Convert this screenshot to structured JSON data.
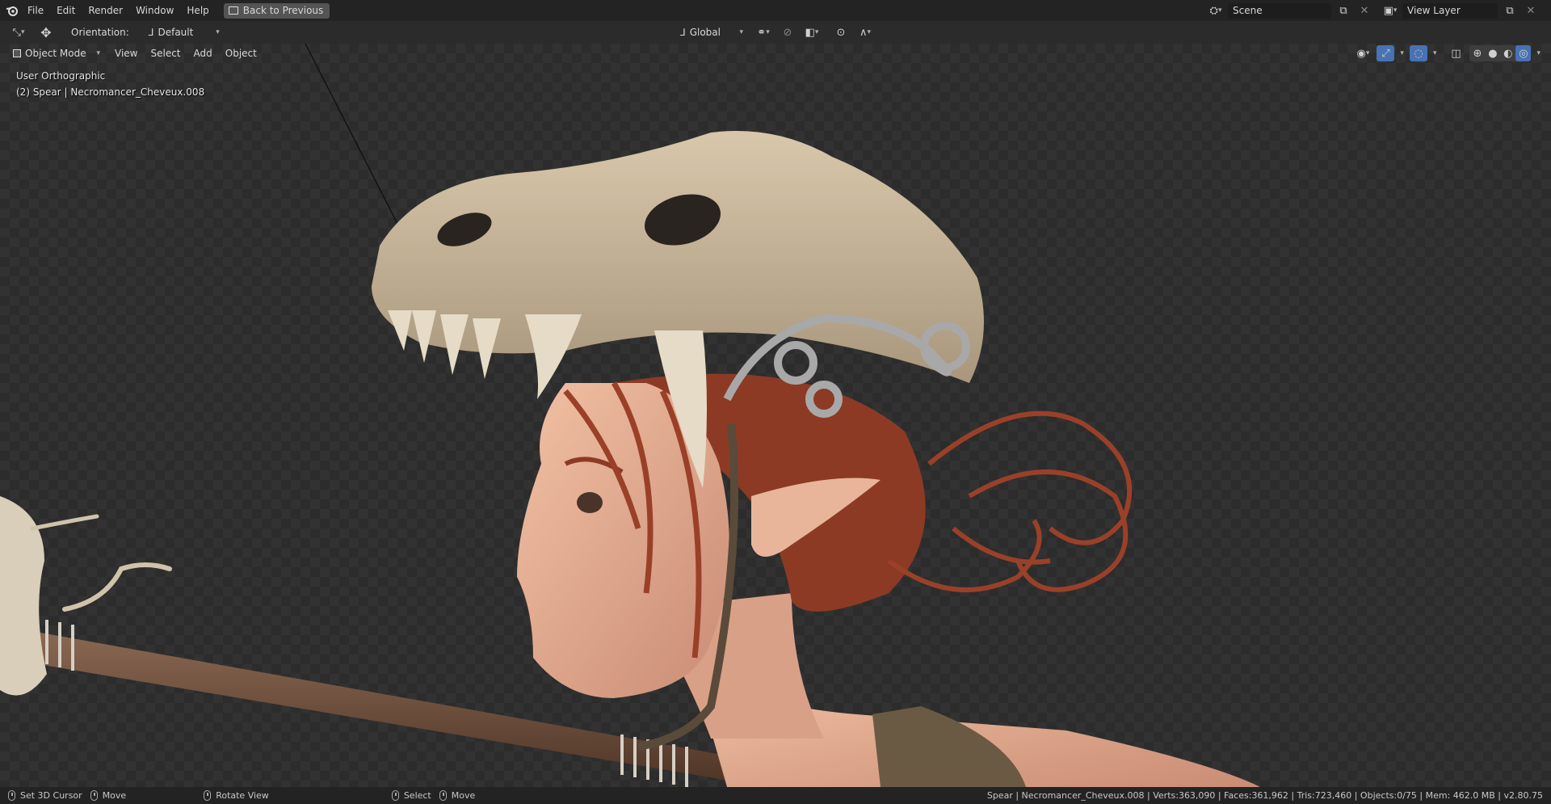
{
  "topbar": {
    "menu": [
      "File",
      "Edit",
      "Render",
      "Window",
      "Help"
    ],
    "back_label": "Back to Previous",
    "scene_value": "Scene",
    "view_layer_value": "View Layer"
  },
  "toolbar": {
    "orientation_label": "Orientation:",
    "orientation_value": "Default",
    "transform_orientation": "Global"
  },
  "viewport": {
    "mode_label": "Object Mode",
    "menu": [
      "View",
      "Select",
      "Add",
      "Object"
    ],
    "view_name": "User Orthographic",
    "active_object": "(2) Spear | Necromancer_Cheveux.008"
  },
  "statusbar": {
    "left_action": "Set 3D Cursor",
    "left_move": "Move",
    "middle_action": "Rotate View",
    "right_select": "Select",
    "right_move": "Move",
    "stats": "Spear | Necromancer_Cheveux.008 | Verts:363,090 | Faces:361,962 | Tris:723,460 | Objects:0/75 | Mem: 462.0 MB | v2.80.75"
  },
  "colors": {
    "accent": "#4772b3",
    "topbar": "#232323",
    "header": "#2b2b2b"
  }
}
